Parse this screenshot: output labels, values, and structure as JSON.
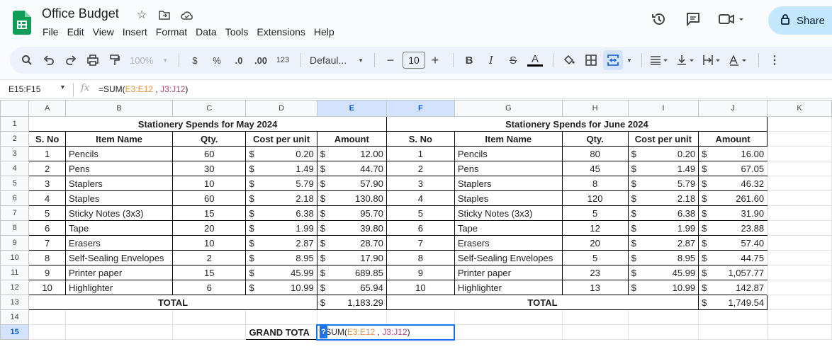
{
  "app": {
    "title": "Office Budget",
    "menu": [
      "File",
      "Edit",
      "View",
      "Insert",
      "Format",
      "Data",
      "Tools",
      "Extensions",
      "Help"
    ],
    "share_label": "Share"
  },
  "toolbar": {
    "zoom": "100%",
    "currency": "$",
    "percent": "%",
    "dec_minus": ".0",
    "dec_plus": ".00",
    "format_123": "123",
    "font": "Defaul...",
    "font_size": "10"
  },
  "formula_bar": {
    "namebox": "E15:F15",
    "fx": "fx",
    "formula_prefix": "=SUM(",
    "ref1": "E3:E12",
    "sep": " , ",
    "ref2": "J3:J12",
    "formula_suffix": ")"
  },
  "columns": [
    "A",
    "B",
    "C",
    "D",
    "E",
    "F",
    "G",
    "H",
    "I",
    "J",
    "K"
  ],
  "rows": [
    "1",
    "2",
    "3",
    "4",
    "5",
    "6",
    "7",
    "8",
    "9",
    "10",
    "11",
    "12",
    "13",
    "14",
    "15"
  ],
  "may": {
    "title": "Stationery Spends for May 2024",
    "headers": [
      "S. No",
      "Item Name",
      "Qty.",
      "Cost per unit",
      "Amount"
    ],
    "items": [
      {
        "no": "1",
        "name": "Pencils",
        "qty": "60",
        "cost": "0.20",
        "amount": "12.00"
      },
      {
        "no": "2",
        "name": "Pens",
        "qty": "30",
        "cost": "1.49",
        "amount": "44.70"
      },
      {
        "no": "3",
        "name": "Staplers",
        "qty": "10",
        "cost": "5.79",
        "amount": "57.90"
      },
      {
        "no": "4",
        "name": "Staples",
        "qty": "60",
        "cost": "2.18",
        "amount": "130.80"
      },
      {
        "no": "5",
        "name": "Sticky Notes (3x3)",
        "qty": "15",
        "cost": "6.38",
        "amount": "95.70"
      },
      {
        "no": "6",
        "name": "Tape",
        "qty": "20",
        "cost": "1.99",
        "amount": "39.80"
      },
      {
        "no": "7",
        "name": "Erasers",
        "qty": "10",
        "cost": "2.87",
        "amount": "28.70"
      },
      {
        "no": "8",
        "name": "Self-Sealing Envelopes",
        "qty": "2",
        "cost": "8.95",
        "amount": "17.90"
      },
      {
        "no": "9",
        "name": "Printer paper",
        "qty": "15",
        "cost": "45.99",
        "amount": "689.85"
      },
      {
        "no": "10",
        "name": "Highlighter",
        "qty": "6",
        "cost": "10.99",
        "amount": "65.94"
      }
    ],
    "total_label": "TOTAL",
    "total": "1,183.29"
  },
  "june": {
    "title": "Stationery Spends for June 2024",
    "headers": [
      "S. No",
      "Item Name",
      "Qty.",
      "Cost per unit",
      "Amount"
    ],
    "items": [
      {
        "no": "1",
        "name": "Pencils",
        "qty": "80",
        "cost": "0.20",
        "amount": "16.00"
      },
      {
        "no": "2",
        "name": "Pens",
        "qty": "45",
        "cost": "1.49",
        "amount": "67.05"
      },
      {
        "no": "3",
        "name": "Staplers",
        "qty": "8",
        "cost": "5.79",
        "amount": "46.32"
      },
      {
        "no": "4",
        "name": "Staples",
        "qty": "120",
        "cost": "2.18",
        "amount": "261.60"
      },
      {
        "no": "5",
        "name": "Sticky Notes (3x3)",
        "qty": "5",
        "cost": "6.38",
        "amount": "31.90"
      },
      {
        "no": "6",
        "name": "Tape",
        "qty": "12",
        "cost": "1.99",
        "amount": "23.88"
      },
      {
        "no": "7",
        "name": "Erasers",
        "qty": "20",
        "cost": "2.87",
        "amount": "57.40"
      },
      {
        "no": "8",
        "name": "Self-Sealing Envelopes",
        "qty": "5",
        "cost": "8.95",
        "amount": "44.75"
      },
      {
        "no": "9",
        "name": "Printer paper",
        "qty": "23",
        "cost": "45.99",
        "amount": "1,057.77"
      },
      {
        "no": "10",
        "name": "Highlighter",
        "qty": "13",
        "cost": "10.99",
        "amount": "142.87"
      }
    ],
    "total_label": "TOTAL",
    "total": "1,749.54"
  },
  "currency_symbol": "$",
  "grand_total_label": "GRAND TOTA",
  "editing_cell": {
    "help": "?",
    "prefix": "=SUM(",
    "ref1": "E3:E12",
    "sep": " , ",
    "ref2": "J3:J12",
    "suffix": ")"
  },
  "colors": {
    "ref_e": "#e69138",
    "ref_j": "#a64d79",
    "selection": "#1a73e8",
    "accent": "#c2e7ff"
  }
}
